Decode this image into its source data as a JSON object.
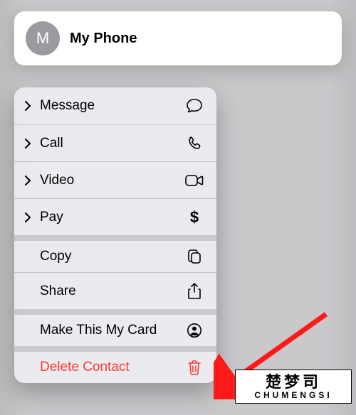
{
  "contact": {
    "monogram": "M",
    "name": "My Phone"
  },
  "menu": {
    "message": "Message",
    "call": "Call",
    "video": "Video",
    "pay": "Pay",
    "copy": "Copy",
    "share": "Share",
    "my_card": "Make This My Card",
    "delete": "Delete Contact"
  },
  "watermark": {
    "cn": "楚梦司",
    "pinyin": "CHUMENGSI"
  },
  "colors": {
    "destructive": "#ff3b30",
    "card_bg": "#ffffff",
    "menu_bg": "rgba(240,240,243,0.86)",
    "avatar_bg": "#9b9aa1"
  }
}
